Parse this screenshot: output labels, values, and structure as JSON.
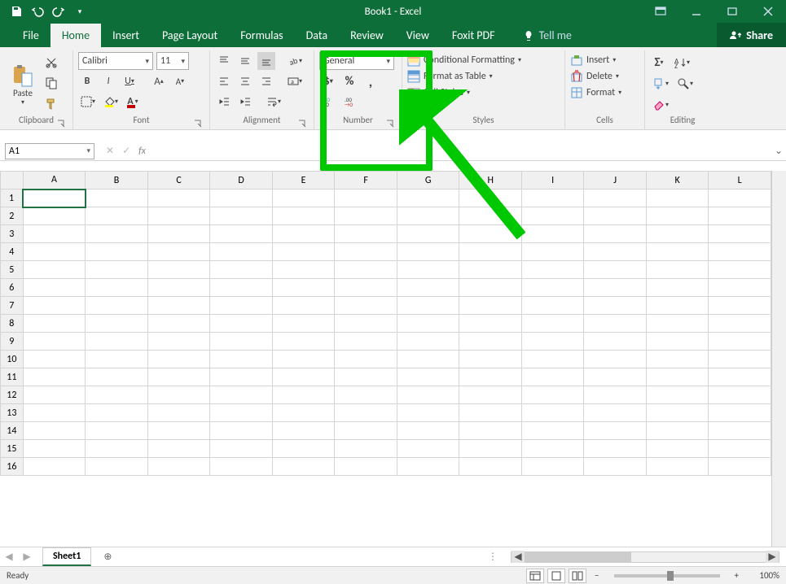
{
  "title": "Book1 - Excel",
  "tabs": [
    "File",
    "Home",
    "Insert",
    "Page Layout",
    "Formulas",
    "Data",
    "Review",
    "View",
    "Foxit PDF"
  ],
  "active_tab": "Home",
  "tellme": "Tell me",
  "share": "Share",
  "ribbon": {
    "clipboard": {
      "label": "Clipboard",
      "paste": "Paste"
    },
    "font": {
      "label": "Font",
      "name": "Calibri",
      "size": "11",
      "bold": "B",
      "italic": "I",
      "underline": "U"
    },
    "alignment": {
      "label": "Alignment"
    },
    "number": {
      "label": "Number",
      "format": "General",
      "currency": "$",
      "percent": "%",
      "comma": ",",
      "incdec": ".00",
      "decinc": ".00"
    },
    "styles": {
      "label": "Styles",
      "cond": "Conditional Formatting",
      "table": "Format as Table",
      "cell": "Cell Styles"
    },
    "cells": {
      "label": "Cells",
      "insert": "Insert",
      "delete": "Delete",
      "format": "Format"
    },
    "editing": {
      "label": "Editing"
    }
  },
  "namebox": "A1",
  "fx_label": "fx",
  "columns": [
    "A",
    "B",
    "C",
    "D",
    "E",
    "F",
    "G",
    "H",
    "I",
    "J",
    "K",
    "L"
  ],
  "rowcount": 16,
  "sheet_tab": "Sheet1",
  "status": "Ready",
  "zoom": "100%"
}
